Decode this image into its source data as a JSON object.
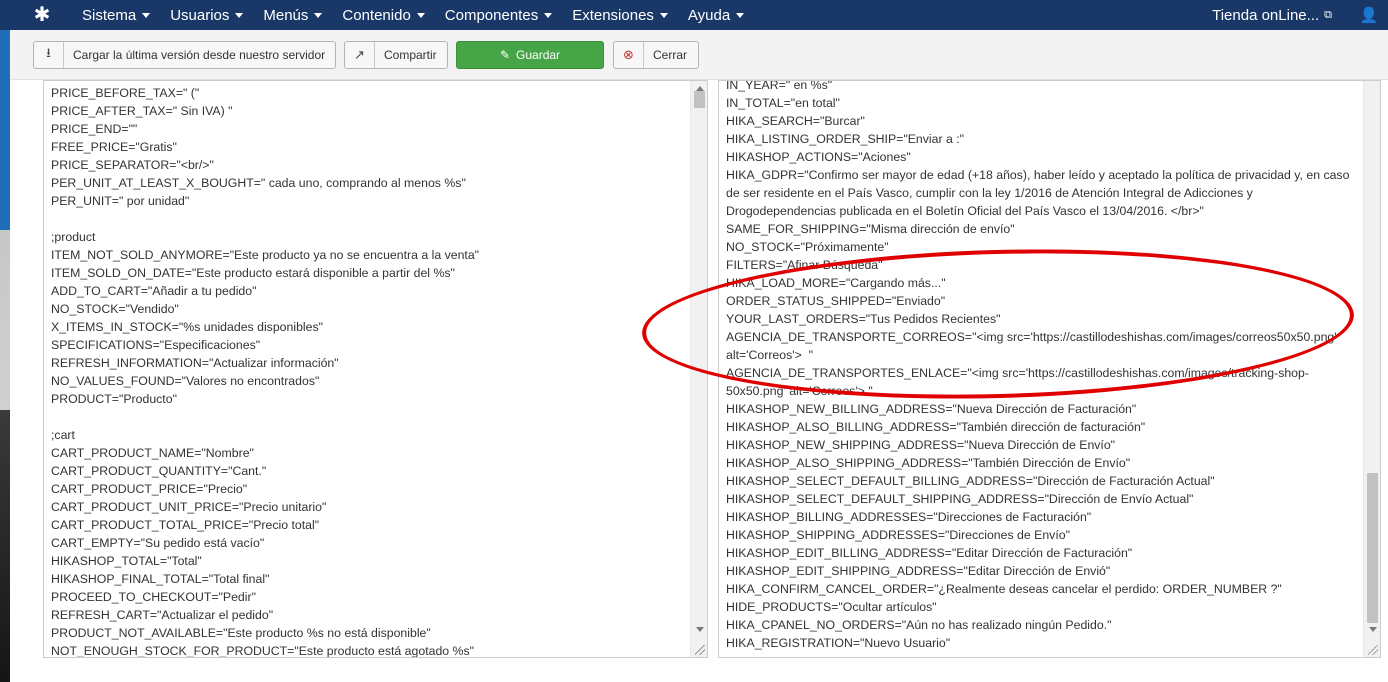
{
  "navbar": {
    "menu": [
      "Sistema",
      "Usuarios",
      "Menús",
      "Contenido",
      "Componentes",
      "Extensiones",
      "Ayuda"
    ],
    "site_name": "Tienda onLine...",
    "logo_icon": "joomla-logo-icon",
    "user_icon": "user-icon"
  },
  "toolbar": {
    "load_label": "Cargar la última versión desde nuestro servidor",
    "share_label": "Compartir",
    "save_label": "Guardar",
    "close_label": "Cerrar",
    "save_color": "#46a546"
  },
  "left_editor": {
    "lines": [
      "PRICE_BEFORE_TAX=\" (\"",
      "PRICE_AFTER_TAX=\" Sin IVA) \"",
      "PRICE_END=\"\"",
      "FREE_PRICE=\"Gratis\"",
      "PRICE_SEPARATOR=\"<br/>\"",
      "PER_UNIT_AT_LEAST_X_BOUGHT=\" cada uno, comprando al menos %s\"",
      "PER_UNIT=\" por unidad\"",
      "",
      ";product",
      "ITEM_NOT_SOLD_ANYMORE=\"Este producto ya no se encuentra a la venta\"",
      "ITEM_SOLD_ON_DATE=\"Este producto estará disponible a partir del %s\"",
      "ADD_TO_CART=\"Añadir a tu pedido\"",
      "NO_STOCK=\"Vendido\"",
      "X_ITEMS_IN_STOCK=\"%s unidades disponibles\"",
      "SPECIFICATIONS=\"Especificaciones\"",
      "REFRESH_INFORMATION=\"Actualizar información\"",
      "NO_VALUES_FOUND=\"Valores no encontrados\"",
      "PRODUCT=\"Producto\"",
      "",
      ";cart",
      "CART_PRODUCT_NAME=\"Nombre\"",
      "CART_PRODUCT_QUANTITY=\"Cant.\"",
      "CART_PRODUCT_PRICE=\"Precio\"",
      "CART_PRODUCT_UNIT_PRICE=\"Precio unitario\"",
      "CART_PRODUCT_TOTAL_PRICE=\"Precio total\"",
      "CART_EMPTY=\"Su pedido está vacío\"",
      "HIKASHOP_TOTAL=\"Total\"",
      "HIKASHOP_FINAL_TOTAL=\"Total final\"",
      "PROCEED_TO_CHECKOUT=\"Pedir\"",
      "REFRESH_CART=\"Actualizar el pedido\"",
      "PRODUCT_NOT_AVAILABLE=\"Este producto %s no está disponible\"",
      "NOT_ENOUGH_STOCK_FOR_PRODUCT=\"Este producto está agotado %s\""
    ]
  },
  "right_editor": {
    "lines": [
      "IN_YEAR=\" en %s\"",
      "IN_TOTAL=\"en total\"",
      "HIKA_SEARCH=\"Burcar\"",
      "HIKA_LISTING_ORDER_SHIP=\"Enviar a :\"",
      "HIKASHOP_ACTIONS=\"Aciones\"",
      "HIKA_GDPR=\"Confirmo ser mayor de edad (+18 años), haber leído y aceptado la política de privacidad y, en caso de ser residente en el País Vasco, cumplir con la ley 1/2016 de Atención Integral de Adicciones y Drogodependencias publicada en el Boletín Oficial del País Vasco el 13/04/2016. </br>\"",
      "SAME_FOR_SHIPPING=\"Misma dirección de envío\"",
      "NO_STOCK=\"Próximamente\"",
      "FILTERS=\"Afinar Búsqueda\"",
      "HIKA_LOAD_MORE=\"Cargando más...\"",
      "ORDER_STATUS_SHIPPED=\"Enviado\"",
      "YOUR_LAST_ORDERS=\"Tus Pedidos Recientes\"",
      "AGENCIA_DE_TRANSPORTE_CORREOS=\"<img src='https://castillodeshishas.com/images/correos50x50.png' alt='Correos'>  \"",
      "AGENCIA_DE_TRANSPORTES_ENLACE=\"<img src='https://castillodeshishas.com/images/tracking-shop-50x50.png' alt='Correos'> \"",
      "HIKASHOP_NEW_BILLING_ADDRESS=\"Nueva Dirección de Facturación\"",
      "HIKASHOP_ALSO_BILLING_ADDRESS=\"También dirección de facturación\"",
      "HIKASHOP_NEW_SHIPPING_ADDRESS=\"Nueva Dirección de Envío\"",
      "HIKASHOP_ALSO_SHIPPING_ADDRESS=\"También Dirección de Envío\"",
      "HIKASHOP_SELECT_DEFAULT_BILLING_ADDRESS=\"Dirección de Facturación Actual\"",
      "HIKASHOP_SELECT_DEFAULT_SHIPPING_ADDRESS=\"Dirección de Envío Actual\"",
      "HIKASHOP_BILLING_ADDRESSES=\"Direcciones de Facturación\"",
      "HIKASHOP_SHIPPING_ADDRESSES=\"Direcciones de Envío\"",
      "HIKASHOP_EDIT_BILLING_ADDRESS=\"Editar Dirección de Facturación\"",
      "HIKASHOP_EDIT_SHIPPING_ADDRESS=\"Editar Dirección de Envió\"",
      "HIKA_CONFIRM_CANCEL_ORDER=\"¿Realmente deseas cancelar el perdido: ORDER_NUMBER ?\"",
      "HIDE_PRODUCTS=\"Ocultar artículos\"",
      "HIKA_CPANEL_NO_ORDERS=\"Aún no has realizado ningún Pedido.\"",
      "HIKA_REGISTRATION=\"Nuevo Usuario\""
    ]
  },
  "annotation_color": "#e00000"
}
